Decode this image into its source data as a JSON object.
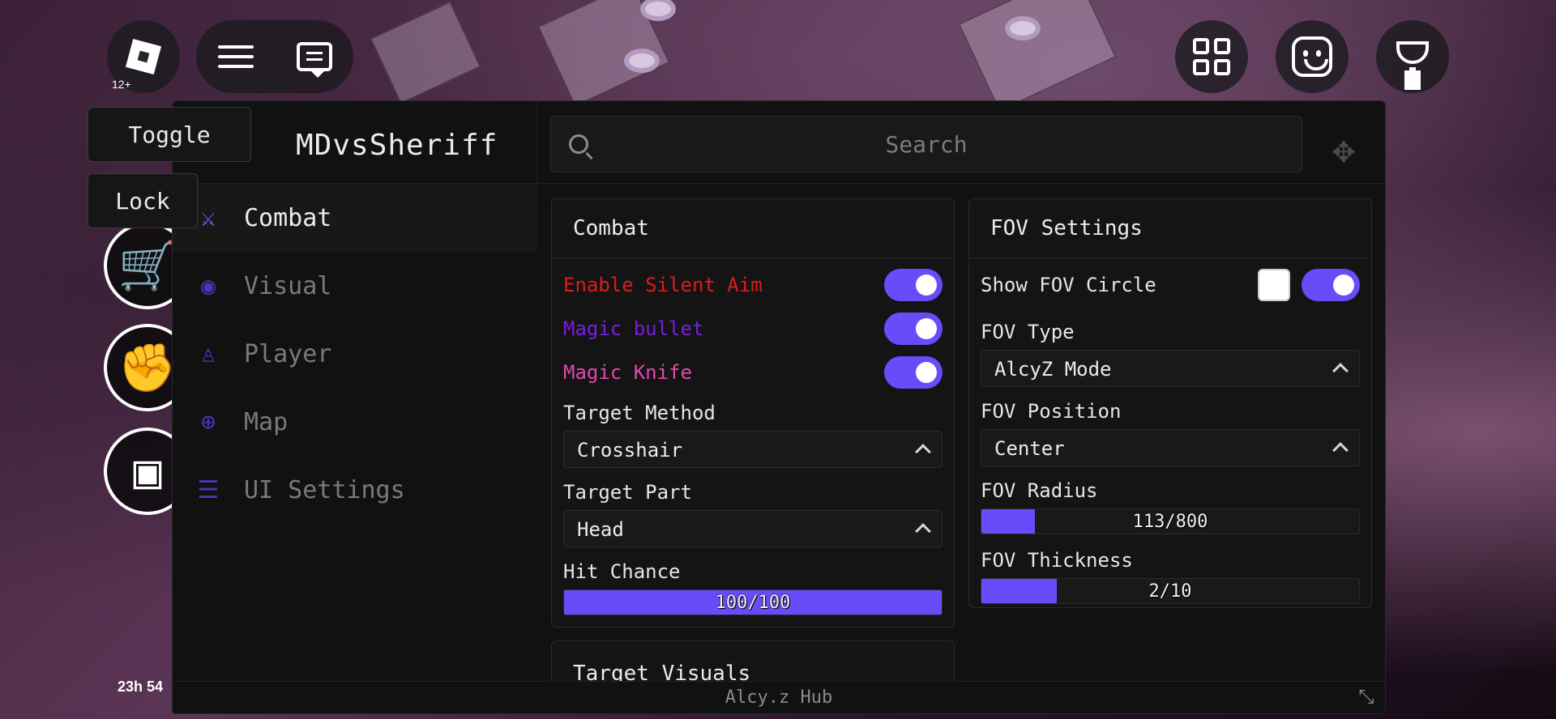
{
  "topbar": {
    "age_rating": "12+"
  },
  "side_tags": {
    "toggle_label": "Toggle",
    "lock_label": "Lock"
  },
  "timer_text": "23h 54",
  "window": {
    "title": "MDvsSheriff",
    "search_placeholder": "Search",
    "footer": "Alcy.z Hub"
  },
  "sidebar": {
    "items": [
      {
        "label": "Combat",
        "icon": "sword-icon",
        "active": true
      },
      {
        "label": "Visual",
        "icon": "eye-icon",
        "active": false
      },
      {
        "label": "Player",
        "icon": "user-icon",
        "active": false
      },
      {
        "label": "Map",
        "icon": "globe-icon",
        "active": false
      },
      {
        "label": "UI Settings",
        "icon": "menu-icon",
        "active": false
      }
    ]
  },
  "combat": {
    "title": "Combat",
    "toggles": [
      {
        "label": "Enable Silent Aim",
        "color": "#e01b1b",
        "on": true
      },
      {
        "label": "Magic bullet",
        "color": "#7a1de0",
        "on": true
      },
      {
        "label": "Magic Knife",
        "color": "#e048b0",
        "on": true
      }
    ],
    "target_method": {
      "label": "Target Method",
      "value": "Crosshair"
    },
    "target_part": {
      "label": "Target Part",
      "value": "Head"
    },
    "hit_chance": {
      "label": "Hit Chance",
      "text": "100/100",
      "fraction": 1.0
    }
  },
  "fov": {
    "title": "FOV Settings",
    "show_circle": {
      "label": "Show FOV Circle",
      "on": true,
      "color_swatch": "#ffffff"
    },
    "fov_type": {
      "label": "FOV Type",
      "value": "AlcyZ Mode"
    },
    "fov_position": {
      "label": "FOV Position",
      "value": "Center"
    },
    "fov_radius": {
      "label": "FOV Radius",
      "text": "113/800",
      "fraction": 0.141
    },
    "fov_thickness": {
      "label": "FOV Thickness",
      "text": "2/10",
      "fraction": 0.2
    }
  },
  "target_visuals": {
    "title": "Target Visuals"
  },
  "colors": {
    "accent": "#6a4bfa",
    "window_bg": "#111111"
  }
}
